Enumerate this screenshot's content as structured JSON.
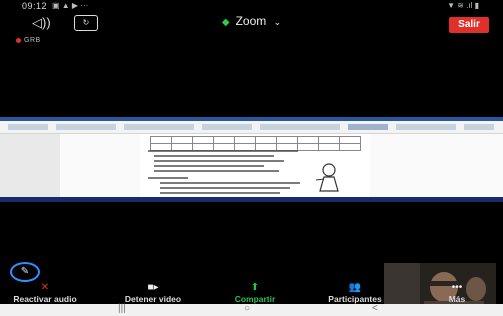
{
  "status_bar": {
    "time": "09:12",
    "left_icons": "▣ ▲ ▶ ···",
    "right_icons": "▼ ≋ .ıl ▮"
  },
  "header": {
    "title": "Zoom",
    "leave_label": "Salir",
    "recording_label": "GRB"
  },
  "toolbar": {
    "items": [
      {
        "label": "Reactivar audio",
        "icon": "microphone-muted-icon"
      },
      {
        "label": "Detener video",
        "icon": "video-camera-icon"
      },
      {
        "label": "Compartir",
        "icon": "share-screen-icon"
      },
      {
        "label": "Participantes",
        "icon": "participants-icon"
      },
      {
        "label": "Más",
        "icon": "more-icon"
      }
    ]
  },
  "nav": {
    "recents": "|||",
    "home": "○",
    "back": "<"
  },
  "colors": {
    "leave": "#e0302a",
    "share": "#2fbf4e",
    "accent": "#2f8fff"
  }
}
